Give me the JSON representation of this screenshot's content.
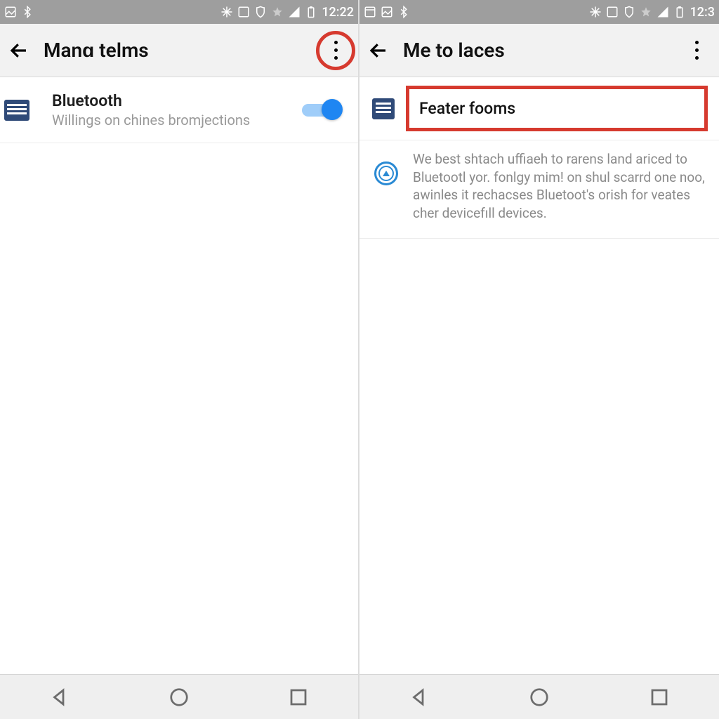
{
  "left": {
    "statusbar": {
      "clock": "12:22"
    },
    "appbar": {
      "title": "Manɑ telms"
    },
    "bluetooth": {
      "title": "Bluetooth",
      "subtitle": "Willings on chines bromjections",
      "enabled": true
    }
  },
  "right": {
    "statusbar": {
      "clock": "12:3"
    },
    "appbar": {
      "title": "Me to laces"
    },
    "menu_item": {
      "label": "Feater fooms"
    },
    "info_text": "We best shtach uffiaeh to rarens land ariced to Bluetootl yor. fonlgy mim! on shul scarrd one noo, awinles it rechacses Bluetoot's orish for veates cher devicefıll devices."
  }
}
